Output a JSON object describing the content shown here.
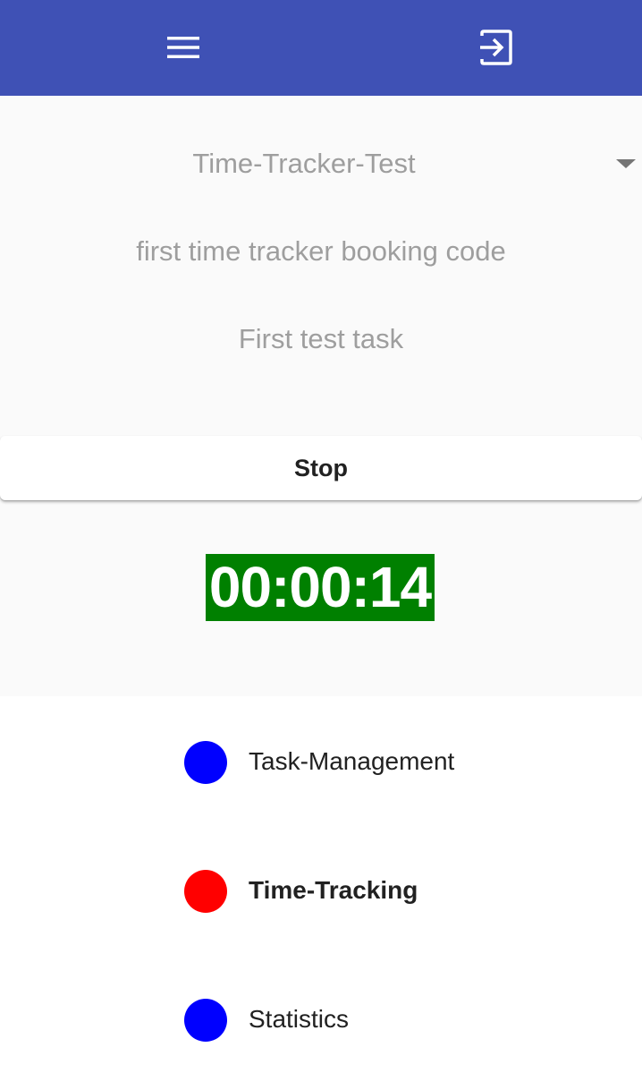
{
  "app_bar": {
    "background_color": "#3f51b5",
    "menu_icon": "hamburger-menu-icon",
    "logout_icon": "exit-to-app-icon"
  },
  "form": {
    "project": {
      "selected": "Time-Tracker-Test",
      "icon": "dropdown-triangle-icon"
    },
    "booking_code": "first time tracker booking code",
    "task": "First test task"
  },
  "stop_button": {
    "label": "Stop"
  },
  "timer": {
    "value": "00:00:14",
    "background_color": "#008000"
  },
  "nav": {
    "items": [
      {
        "label": "Task-Management",
        "dot_color": "#0000ff",
        "active": false
      },
      {
        "label": "Time-Tracking",
        "dot_color": "#ff0000",
        "active": true
      },
      {
        "label": "Statistics",
        "dot_color": "#0000ff",
        "active": false
      }
    ]
  }
}
